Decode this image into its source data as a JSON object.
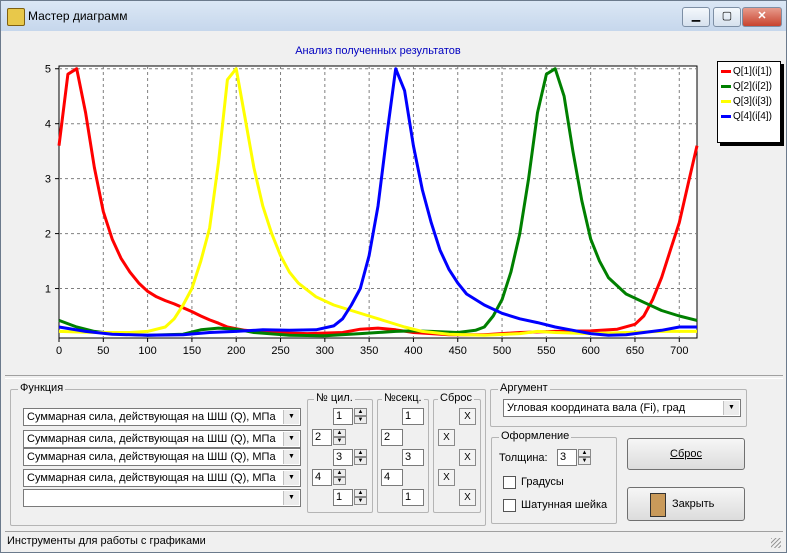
{
  "window": {
    "title": "Мастер диаграмм",
    "minimize_label": "▁",
    "maximize_label": "▢",
    "close_label": "✕"
  },
  "chart_data": {
    "type": "line",
    "title": "Анализ полученных результатов",
    "xlim": [
      0,
      720
    ],
    "ylim": [
      0.1,
      5.05
    ],
    "xticks": [
      0,
      50,
      100,
      150,
      200,
      250,
      300,
      350,
      400,
      450,
      500,
      550,
      600,
      650,
      700
    ],
    "yticks": [
      1,
      2,
      3,
      4,
      5
    ],
    "grid": true,
    "legend_position": "right",
    "series": [
      {
        "name": "Q[1](i[1])",
        "color": "#ff0000",
        "points": [
          [
            0,
            3.6
          ],
          [
            10,
            4.9
          ],
          [
            20,
            5.0
          ],
          [
            30,
            4.2
          ],
          [
            40,
            3.2
          ],
          [
            50,
            2.4
          ],
          [
            60,
            1.9
          ],
          [
            70,
            1.55
          ],
          [
            80,
            1.3
          ],
          [
            90,
            1.1
          ],
          [
            100,
            0.95
          ],
          [
            110,
            0.85
          ],
          [
            120,
            0.78
          ],
          [
            130,
            0.72
          ],
          [
            140,
            0.65
          ],
          [
            150,
            0.58
          ],
          [
            160,
            0.5
          ],
          [
            170,
            0.43
          ],
          [
            180,
            0.37
          ],
          [
            190,
            0.3
          ],
          [
            200,
            0.27
          ],
          [
            210,
            0.24
          ],
          [
            220,
            0.22
          ],
          [
            240,
            0.2
          ],
          [
            280,
            0.18
          ],
          [
            320,
            0.2
          ],
          [
            340,
            0.26
          ],
          [
            360,
            0.28
          ],
          [
            380,
            0.25
          ],
          [
            400,
            0.2
          ],
          [
            440,
            0.16
          ],
          [
            480,
            0.16
          ],
          [
            520,
            0.2
          ],
          [
            560,
            0.22
          ],
          [
            600,
            0.23
          ],
          [
            630,
            0.26
          ],
          [
            650,
            0.35
          ],
          [
            660,
            0.5
          ],
          [
            670,
            0.8
          ],
          [
            680,
            1.2
          ],
          [
            690,
            1.7
          ],
          [
            700,
            2.2
          ],
          [
            710,
            2.9
          ],
          [
            720,
            3.6
          ]
        ]
      },
      {
        "name": "Q[2](i[2])",
        "color": "#008000",
        "points": [
          [
            0,
            0.42
          ],
          [
            20,
            0.3
          ],
          [
            40,
            0.22
          ],
          [
            60,
            0.18
          ],
          [
            100,
            0.15
          ],
          [
            140,
            0.17
          ],
          [
            160,
            0.25
          ],
          [
            180,
            0.28
          ],
          [
            200,
            0.26
          ],
          [
            220,
            0.2
          ],
          [
            260,
            0.15
          ],
          [
            300,
            0.14
          ],
          [
            340,
            0.18
          ],
          [
            360,
            0.2
          ],
          [
            380,
            0.22
          ],
          [
            400,
            0.23
          ],
          [
            420,
            0.22
          ],
          [
            450,
            0.2
          ],
          [
            470,
            0.24
          ],
          [
            480,
            0.3
          ],
          [
            490,
            0.5
          ],
          [
            500,
            0.8
          ],
          [
            510,
            1.3
          ],
          [
            520,
            2.0
          ],
          [
            530,
            3.0
          ],
          [
            540,
            4.2
          ],
          [
            550,
            4.9
          ],
          [
            560,
            5.0
          ],
          [
            570,
            4.5
          ],
          [
            580,
            3.5
          ],
          [
            590,
            2.6
          ],
          [
            600,
            1.9
          ],
          [
            610,
            1.5
          ],
          [
            620,
            1.2
          ],
          [
            640,
            0.9
          ],
          [
            660,
            0.75
          ],
          [
            680,
            0.6
          ],
          [
            700,
            0.5
          ],
          [
            720,
            0.42
          ]
        ]
      },
      {
        "name": "Q[3](i[3])",
        "color": "#ffff00",
        "points": [
          [
            0,
            0.22
          ],
          [
            40,
            0.2
          ],
          [
            80,
            0.2
          ],
          [
            100,
            0.22
          ],
          [
            120,
            0.3
          ],
          [
            130,
            0.45
          ],
          [
            140,
            0.7
          ],
          [
            150,
            1.0
          ],
          [
            160,
            1.5
          ],
          [
            170,
            2.1
          ],
          [
            180,
            3.3
          ],
          [
            190,
            4.8
          ],
          [
            200,
            5.0
          ],
          [
            210,
            4.1
          ],
          [
            220,
            3.2
          ],
          [
            230,
            2.5
          ],
          [
            240,
            2.0
          ],
          [
            250,
            1.6
          ],
          [
            260,
            1.3
          ],
          [
            270,
            1.1
          ],
          [
            290,
            0.85
          ],
          [
            310,
            0.7
          ],
          [
            330,
            0.6
          ],
          [
            350,
            0.5
          ],
          [
            370,
            0.4
          ],
          [
            390,
            0.3
          ],
          [
            410,
            0.22
          ],
          [
            440,
            0.17
          ],
          [
            480,
            0.15
          ],
          [
            520,
            0.18
          ],
          [
            540,
            0.22
          ],
          [
            560,
            0.2
          ],
          [
            600,
            0.18
          ],
          [
            640,
            0.2
          ],
          [
            680,
            0.22
          ],
          [
            720,
            0.22
          ]
        ]
      },
      {
        "name": "Q[4](i[4])",
        "color": "#0000ff",
        "points": [
          [
            0,
            0.3
          ],
          [
            30,
            0.22
          ],
          [
            60,
            0.17
          ],
          [
            100,
            0.15
          ],
          [
            140,
            0.16
          ],
          [
            170,
            0.2
          ],
          [
            200,
            0.22
          ],
          [
            230,
            0.25
          ],
          [
            260,
            0.24
          ],
          [
            290,
            0.25
          ],
          [
            310,
            0.32
          ],
          [
            320,
            0.45
          ],
          [
            330,
            0.7
          ],
          [
            340,
            1.0
          ],
          [
            350,
            1.6
          ],
          [
            360,
            2.5
          ],
          [
            370,
            3.8
          ],
          [
            380,
            5.0
          ],
          [
            390,
            4.6
          ],
          [
            400,
            3.6
          ],
          [
            410,
            2.8
          ],
          [
            420,
            2.2
          ],
          [
            430,
            1.7
          ],
          [
            440,
            1.35
          ],
          [
            450,
            1.1
          ],
          [
            460,
            0.9
          ],
          [
            480,
            0.7
          ],
          [
            500,
            0.55
          ],
          [
            520,
            0.45
          ],
          [
            540,
            0.38
          ],
          [
            560,
            0.3
          ],
          [
            580,
            0.24
          ],
          [
            600,
            0.18
          ],
          [
            620,
            0.15
          ],
          [
            640,
            0.16
          ],
          [
            660,
            0.2
          ],
          [
            680,
            0.24
          ],
          [
            700,
            0.3
          ],
          [
            720,
            0.3
          ]
        ]
      }
    ]
  },
  "function_panel": {
    "label": "Функция",
    "rows": [
      {
        "func": "Суммарная сила, действующая на ШШ (Q), МПа",
        "cyl": "1",
        "sec": "1"
      },
      {
        "func": "Суммарная сила, действующая на ШШ (Q), МПа",
        "cyl": "2",
        "sec": "2"
      },
      {
        "func": "Суммарная сила, действующая на ШШ (Q), МПа",
        "cyl": "3",
        "sec": "3"
      },
      {
        "func": "Суммарная сила, действующая на ШШ (Q), МПа",
        "cyl": "4",
        "sec": "4"
      },
      {
        "func": "",
        "cyl": "1",
        "sec": "1"
      }
    ],
    "cyl_label": "№ цил.",
    "sec_label": "№секц.",
    "reset_label": "Сброс",
    "x_glyph": "X"
  },
  "argument_panel": {
    "label": "Аргумент",
    "value": "Угловая координата вала (Fi), град"
  },
  "design_panel": {
    "label": "Оформление",
    "thickness_label": "Толщина:",
    "thickness_value": "3",
    "degrees_label": "Градусы",
    "degrees_checked": false,
    "journal_label": "Шатунная шейка",
    "journal_checked": false
  },
  "buttons": {
    "reset": "Сброс",
    "close": "Закрыть"
  },
  "status": "Инструменты для работы  с графиками"
}
